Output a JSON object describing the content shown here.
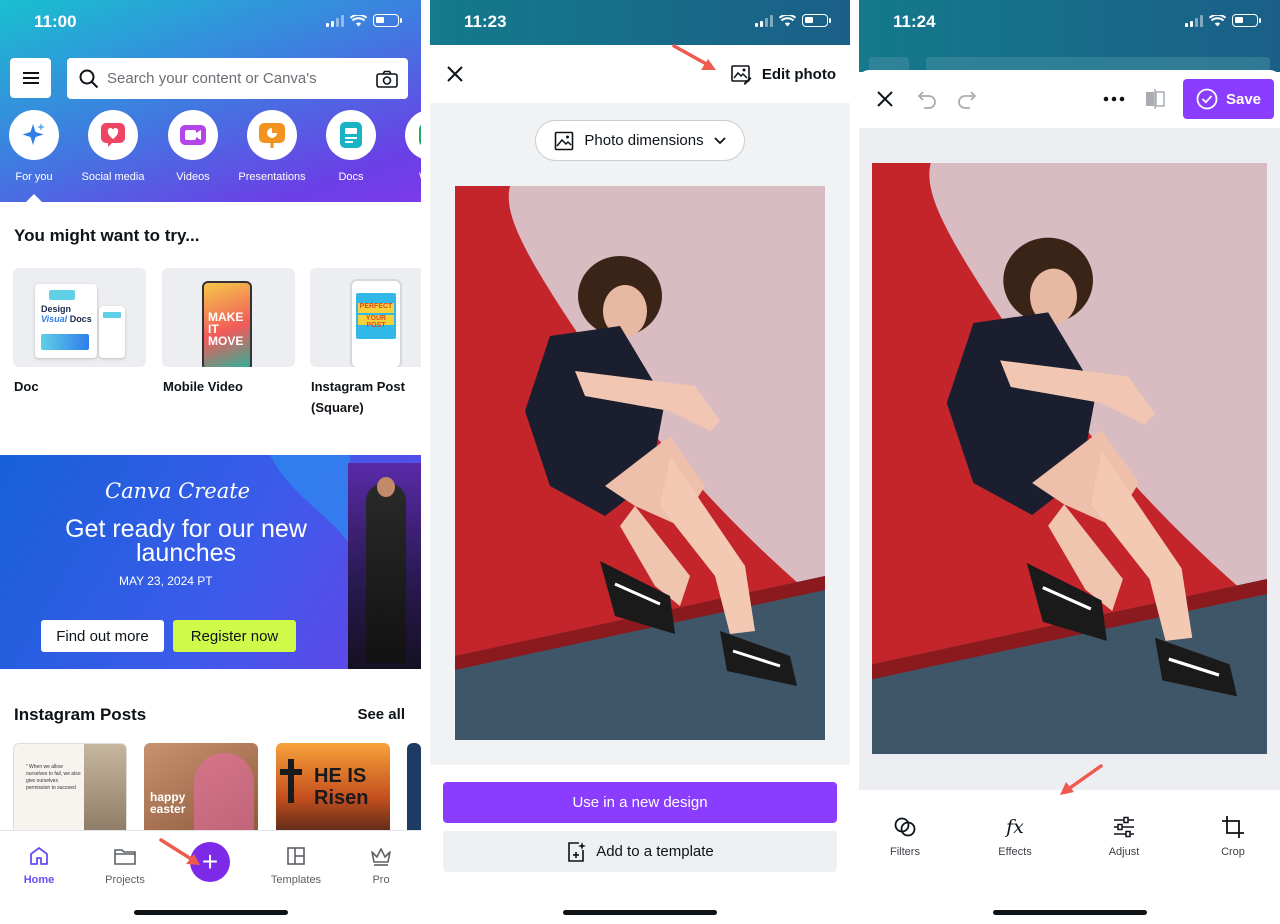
{
  "panel1": {
    "status_time": "11:00",
    "search_placeholder": "Search your content or Canva's",
    "categories": [
      {
        "label": "For you",
        "icon": "sparkle-icon",
        "color": "#2f7de9"
      },
      {
        "label": "Social media",
        "icon": "heart-icon",
        "color": "#ef4565"
      },
      {
        "label": "Videos",
        "icon": "video-camera-icon",
        "color": "#b445e8"
      },
      {
        "label": "Presentations",
        "icon": "presentation-icon",
        "color": "#f2931f"
      },
      {
        "label": "Docs",
        "icon": "document-icon",
        "color": "#19b3c4"
      },
      {
        "label": "Whit",
        "icon": "whiteboard-icon",
        "color": "#1fae63"
      }
    ],
    "try_title": "You might want to try...",
    "try_items": [
      {
        "label": "Doc"
      },
      {
        "label": "Mobile Video"
      },
      {
        "label": "Instagram Post (Square)"
      }
    ],
    "banner": {
      "brand": "Canva Create",
      "headline": "Get ready for our new launches",
      "date": "MAY 23, 2024 PT",
      "find_out_more": "Find out more",
      "register_now": "Register now"
    },
    "instagram_title": "Instagram Posts",
    "see_all": "See all",
    "ig_cards": [
      {
        "text": "“ When we allow ourselves to fail, we also give ourselves permission to succeed"
      },
      {
        "text": "happy easter"
      },
      {
        "text": "HE IS Risen"
      },
      {
        "text": ""
      }
    ],
    "tabs": [
      {
        "label": "Home",
        "icon": "home-icon",
        "active": true
      },
      {
        "label": "Projects",
        "icon": "folder-icon",
        "active": false
      },
      {
        "label": "Templates",
        "icon": "templates-icon",
        "active": false
      },
      {
        "label": "Pro",
        "icon": "crown-icon",
        "active": false
      }
    ],
    "fab_symbol": "+"
  },
  "panel2": {
    "status_time": "11:23",
    "edit_photo": "Edit photo",
    "photo_dimensions": "Photo dimensions",
    "use_in_new_design": "Use in a new design",
    "add_to_template": "Add to a template"
  },
  "panel3": {
    "status_time": "11:24",
    "save": "Save",
    "tools": [
      {
        "label": "Filters",
        "icon": "filters-icon"
      },
      {
        "label": "Effects",
        "icon": "effects-icon"
      },
      {
        "label": "Adjust",
        "icon": "adjust-icon"
      },
      {
        "label": "Crop",
        "icon": "crop-icon"
      }
    ]
  },
  "colors": {
    "brand_purple": "#8b3dff",
    "arrow_red": "#ef5a4f",
    "lime": "#cffa4a"
  }
}
